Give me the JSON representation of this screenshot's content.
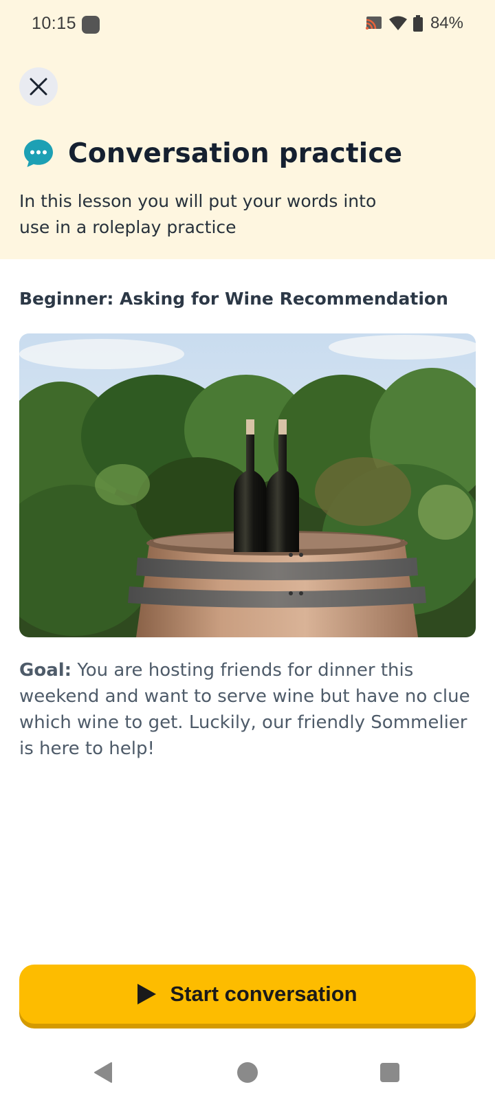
{
  "status_bar": {
    "time": "10:15",
    "battery": "84%",
    "icons": [
      "app-notification-icon",
      "cast-icon",
      "wifi-icon",
      "battery-icon"
    ]
  },
  "header": {
    "close_icon": "close-icon",
    "title": "Conversation practice",
    "title_icon": "chat-bubble-icon",
    "subtitle": "In this lesson you will put your words into use in a roleplay practice"
  },
  "lesson": {
    "title": "Beginner: Asking for Wine Recommendation",
    "goal_label": "Goal:",
    "goal_text": " You are hosting friends for dinner this weekend and want to serve wine but have no clue which wine to get. Luckily, our friendly Sommelier is here to help!"
  },
  "actions": {
    "start_label": "Start conversation",
    "start_icon": "play-icon"
  },
  "nav_bar": {
    "icons": [
      "back-icon",
      "home-icon",
      "recents-icon"
    ]
  },
  "colors": {
    "header_bg": "#fef6e0",
    "accent": "#fdbc00",
    "chat_icon": "#1da0b4"
  }
}
